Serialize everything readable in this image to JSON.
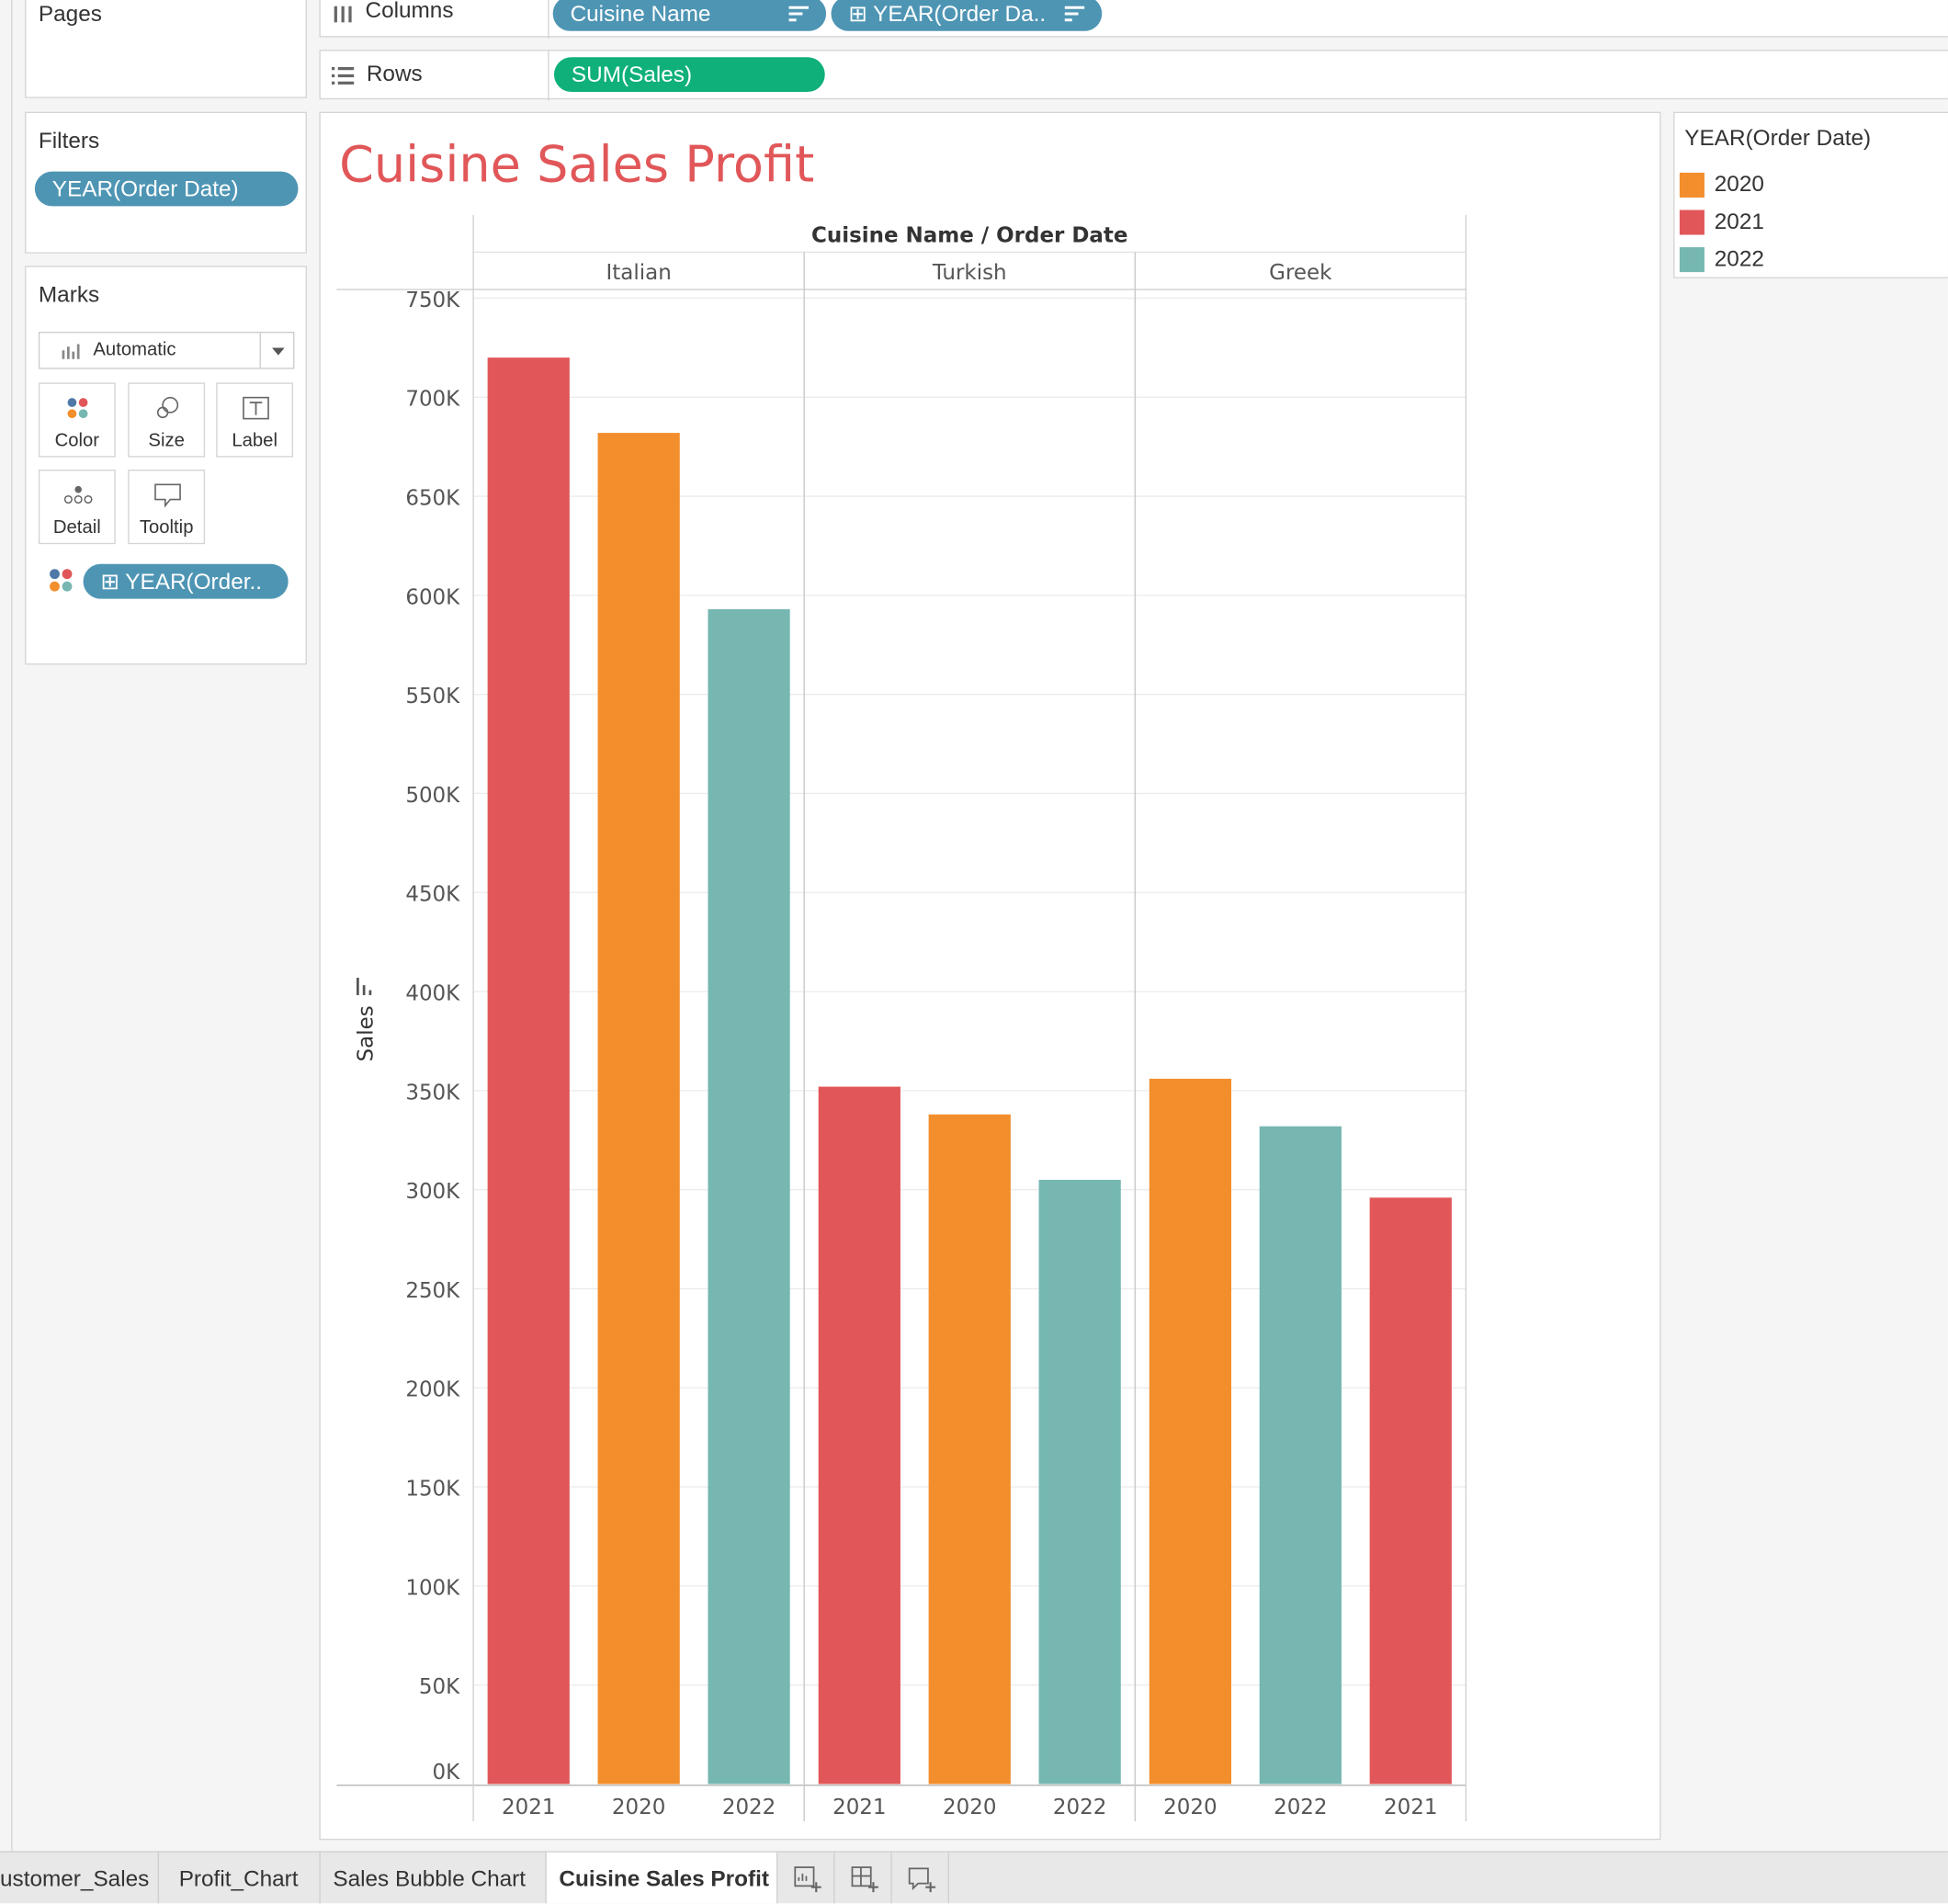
{
  "side": {
    "pages_label": "Pages",
    "filters_label": "Filters",
    "filter_pill": "YEAR(Order Date)",
    "marks_label": "Marks",
    "mark_type": "Automatic",
    "buttons": {
      "color": "Color",
      "size": "Size",
      "label": "Label",
      "detail": "Detail",
      "tooltip": "Tooltip"
    },
    "marks_pill": "YEAR(Order..",
    "marks_pill_prefix": "⊞"
  },
  "shelves": {
    "columns_label": "Columns",
    "rows_label": "Rows",
    "columns_pills": [
      "Cuisine Name",
      "YEAR(Order Da.."
    ],
    "columns_pill2_prefix": "⊞",
    "rows_pill": "SUM(Sales)"
  },
  "view": {
    "title": "Cuisine Sales Profit",
    "header": "Cuisine Name  /  Order Date"
  },
  "legend": {
    "title": "YEAR(Order Date)",
    "items": [
      {
        "label": "2020",
        "color": "#f28e2b"
      },
      {
        "label": "2021",
        "color": "#e15759"
      },
      {
        "label": "2022",
        "color": "#76b7b2"
      }
    ]
  },
  "chart_data": {
    "type": "bar",
    "title": "Cuisine Sales Profit",
    "xlabel": "Cuisine Name / Order Date",
    "ylabel": "Sales",
    "ylim": [
      0,
      750000
    ],
    "y_ticks": [
      0,
      50000,
      100000,
      150000,
      200000,
      250000,
      300000,
      350000,
      400000,
      450000,
      500000,
      550000,
      600000,
      650000,
      700000,
      750000
    ],
    "y_tick_labels": [
      "0K",
      "50K",
      "100K",
      "150K",
      "200K",
      "250K",
      "300K",
      "350K",
      "400K",
      "450K",
      "500K",
      "550K",
      "600K",
      "650K",
      "700K",
      "750K"
    ],
    "colors": {
      "2020": "#f28e2b",
      "2021": "#e15759",
      "2022": "#76b7b2"
    },
    "groups": [
      {
        "name": "Italian",
        "bars": [
          {
            "year": "2021",
            "value": 720000
          },
          {
            "year": "2020",
            "value": 682000
          },
          {
            "year": "2022",
            "value": 593000
          }
        ]
      },
      {
        "name": "Turkish",
        "bars": [
          {
            "year": "2021",
            "value": 352000
          },
          {
            "year": "2020",
            "value": 338000
          },
          {
            "year": "2022",
            "value": 305000
          }
        ]
      },
      {
        "name": "Greek",
        "bars": [
          {
            "year": "2020",
            "value": 356000
          },
          {
            "year": "2022",
            "value": 332000
          },
          {
            "year": "2021",
            "value": 296000
          }
        ]
      }
    ],
    "grid": true,
    "legend_position": "right"
  },
  "tabs": [
    {
      "label": "ustomer_Sales",
      "active": false
    },
    {
      "label": "Profit_Chart",
      "active": false
    },
    {
      "label": "Sales Bubble Chart",
      "active": false
    },
    {
      "label": "Cuisine Sales Profit",
      "active": true
    }
  ]
}
